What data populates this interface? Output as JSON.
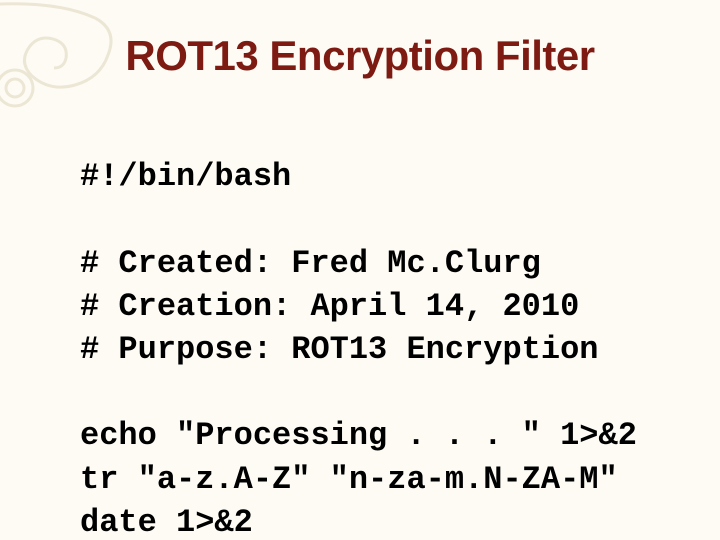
{
  "title": "ROT13 Encryption Filter",
  "code": {
    "l1": "#!/bin/bash",
    "l2": "",
    "l3": "# Created: Fred Mc.Clurg",
    "l4": "# Creation: April 14, 2010",
    "l5": "# Purpose: ROT13 Encryption",
    "l6": "",
    "l7": "echo \"Processing . . . \" 1>&2",
    "l8": "tr \"a-z.A-Z\" \"n-za-m.N-ZA-M\"",
    "l9": "date 1>&2"
  }
}
